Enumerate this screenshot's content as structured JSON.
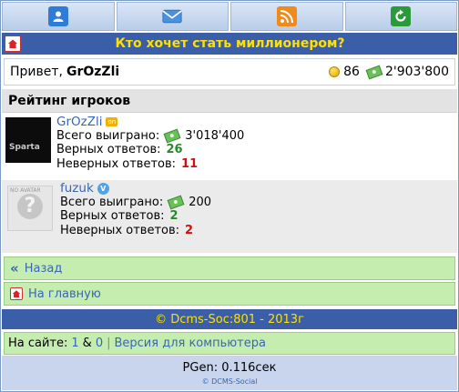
{
  "topbar": {
    "icons": [
      "user-icon",
      "mail-icon",
      "rss-icon",
      "refresh-icon"
    ],
    "colors": {
      "user": "#2f7bd6",
      "mail": "#3d86d8",
      "rss": "#f08a1a",
      "refresh": "#2a9a3a"
    }
  },
  "header": {
    "title": "Кто хочет стать миллионером?"
  },
  "greeting": {
    "prefix": "Привет,",
    "username": "GrOzZli",
    "coins": "86",
    "money": "2'903'800"
  },
  "rating": {
    "title": "Рейтинг игроков",
    "players": [
      {
        "avatar_text": "Sparta",
        "name": "GrOzZli",
        "badge": "on",
        "total_label": "Всего выиграно:",
        "total": "3'018'400",
        "correct_label": "Верных ответов:",
        "correct": "26",
        "wrong_label": "Неверных ответов:",
        "wrong": "11"
      },
      {
        "avatar_text": "NO AVATAR",
        "name": "fuzuk",
        "badge": "V",
        "total_label": "Всего выиграно:",
        "total": "200",
        "correct_label": "Верных ответов:",
        "correct": "2",
        "wrong_label": "Неверных ответов:",
        "wrong": "2"
      }
    ]
  },
  "nav": {
    "back_chevrons": "«",
    "back_label": "Назад",
    "home_label": "На главную"
  },
  "footer": {
    "copyright": "© Dcms-Soc:801 - 2013г",
    "online_label": "На сайте:",
    "online_users": "1",
    "online_sep": "&",
    "online_guests": "0",
    "divider": "|",
    "desktop_link": "Версия для компьютера",
    "pgen": "PGen: 0.116сек",
    "engine": "© DCMS-Social"
  }
}
